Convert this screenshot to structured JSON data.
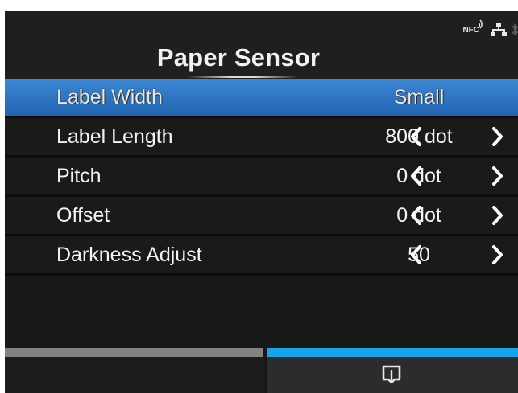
{
  "header": {
    "title": "Paper Sensor",
    "status_icons": [
      "nfc-icon",
      "lan-icon",
      "bluetooth-icon"
    ],
    "nfc_text": "NFC"
  },
  "menu": {
    "items": [
      {
        "label": "Label Width",
        "value": "Small",
        "selected": true,
        "has_arrows": false
      },
      {
        "label": "Label Length",
        "value": "800 dot",
        "selected": false,
        "has_arrows": true
      },
      {
        "label": "Pitch",
        "value": "0 dot",
        "selected": false,
        "has_arrows": true
      },
      {
        "label": "Offset",
        "value": "0 dot",
        "selected": false,
        "has_arrows": true
      },
      {
        "label": "Darkness Adjust",
        "value": "50",
        "selected": false,
        "has_arrows": true
      }
    ]
  },
  "footer": {
    "right_button_icon": "screen-return-icon"
  },
  "colors": {
    "background": "#181818",
    "selected_row": "#2f78c4",
    "accent_tab": "#15a6ea",
    "inactive_tab": "#828282"
  }
}
